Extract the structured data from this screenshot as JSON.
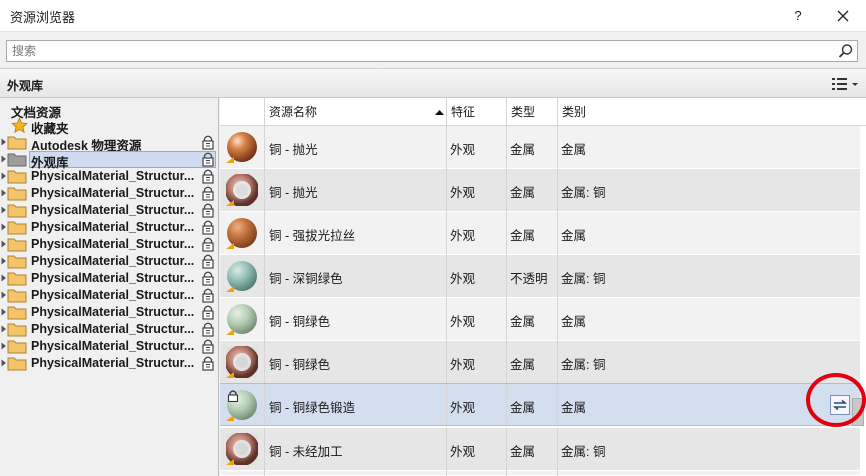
{
  "window": {
    "title": "资源浏览器",
    "help": "?"
  },
  "search": {
    "placeholder": "搜索"
  },
  "library_bar": {
    "title": "外观库"
  },
  "tree": {
    "items": [
      {
        "label": "文档资源"
      },
      {
        "label": "收藏夹"
      },
      {
        "label": "Autodesk 物理资源"
      },
      {
        "label": "外观库"
      },
      {
        "label": "PhysicalMaterial_Structur..."
      },
      {
        "label": "PhysicalMaterial_Structur..."
      },
      {
        "label": "PhysicalMaterial_Structur..."
      },
      {
        "label": "PhysicalMaterial_Structur..."
      },
      {
        "label": "PhysicalMaterial_Structur..."
      },
      {
        "label": "PhysicalMaterial_Structur..."
      },
      {
        "label": "PhysicalMaterial_Structur..."
      },
      {
        "label": "PhysicalMaterial_Structur..."
      },
      {
        "label": "PhysicalMaterial_Structur..."
      },
      {
        "label": "PhysicalMaterial_Structur..."
      },
      {
        "label": "PhysicalMaterial_Structur..."
      },
      {
        "label": "PhysicalMaterial_Structur..."
      }
    ]
  },
  "table": {
    "columns": [
      "资源名称",
      "特征",
      "类型",
      "类别"
    ],
    "rows": [
      {
        "name": "铜 - 抛光",
        "feature": "外观",
        "type": "金属",
        "category": "金属",
        "thumb": "sphere-copper"
      },
      {
        "name": "铜 - 抛光",
        "feature": "外观",
        "type": "金属",
        "category": "金属: 铜",
        "thumb": "torus-copper"
      },
      {
        "name": "铜 - 强拔光拉丝",
        "feature": "外观",
        "type": "金属",
        "category": "金属",
        "thumb": "sphere-brushed"
      },
      {
        "name": "铜 - 深铜绿色",
        "feature": "外观",
        "type": "不透明",
        "category": "金属: 铜",
        "thumb": "sphere-patina-dark"
      },
      {
        "name": "铜 - 铜绿色",
        "feature": "外观",
        "type": "金属",
        "category": "金属",
        "thumb": "sphere-patina"
      },
      {
        "name": "铜 - 铜绿色",
        "feature": "外观",
        "type": "金属",
        "category": "金属: 铜",
        "thumb": "torus-patina"
      },
      {
        "name": "铜 - 铜绿色锻造",
        "feature": "外观",
        "type": "金属",
        "category": "金属",
        "thumb": "sphere-patina-forged"
      },
      {
        "name": "铜 - 未经加工",
        "feature": "外观",
        "type": "金属",
        "category": "金属: 铜",
        "thumb": "torus-raw"
      }
    ]
  },
  "colors": {
    "selection": "#d3deee",
    "highlight_circle": "#e1000f",
    "accent": "#f5a200"
  }
}
